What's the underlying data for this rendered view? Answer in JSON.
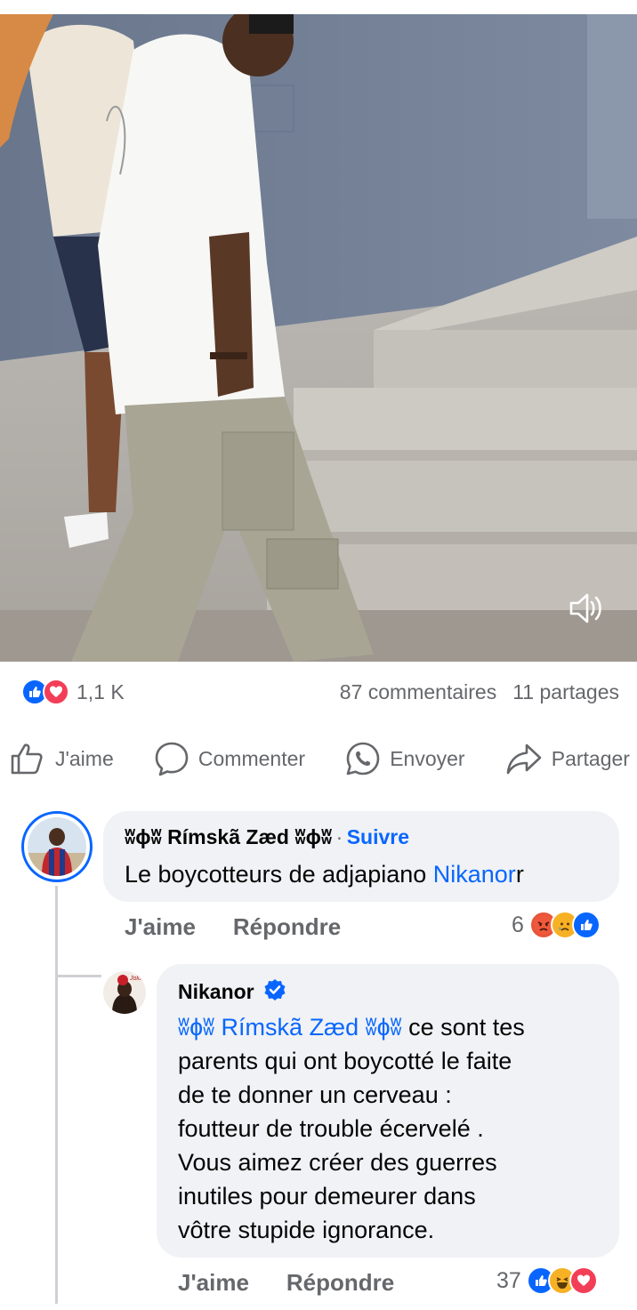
{
  "post": {
    "reactions_count": "1,1 K",
    "comments_count": "87 commentaires",
    "shares_count": "11 partages",
    "reaction_icons": [
      "like-icon",
      "love-icon"
    ]
  },
  "actions": {
    "like": "J'aime",
    "comment": "Commenter",
    "send": "Envoyer",
    "share": "Partager"
  },
  "comment1": {
    "author": "ʬɸʬ Rímskã Zæd ʬɸʬ",
    "separator": "·",
    "follow": "Suivre",
    "text": "Le boycotteurs de adjapiano ",
    "mention": "Nikanor",
    "text_suffix": "r",
    "like": "J'aime",
    "reply": "Répondre",
    "reaction_count": "6",
    "reaction_icons": [
      "angry-icon",
      "sad-icon",
      "like-icon"
    ]
  },
  "comment2": {
    "author": "Nikanor",
    "verified": true,
    "mention": "ʬɸʬ Rímskã Zæd ʬɸʬ",
    "text_line1": " ce sont tes",
    "text_line2": "parents qui ont boycotté le faite",
    "text_line3": "de te donner un cerveau :",
    "text_line4": "foutteur de trouble écervelé .",
    "text_line5": "Vous aimez créer des guerres",
    "text_line6": "inutiles pour demeurer dans",
    "text_line7": "vôtre stupide ignorance.",
    "like": "J'aime",
    "reply": "Répondre",
    "reaction_count": "37",
    "reaction_icons": [
      "like-icon",
      "haha-icon",
      "love-icon"
    ]
  },
  "colors": {
    "accent": "#0866ff",
    "love": "#f33e58",
    "muted": "#65676b",
    "bubble": "#f0f2f5"
  }
}
